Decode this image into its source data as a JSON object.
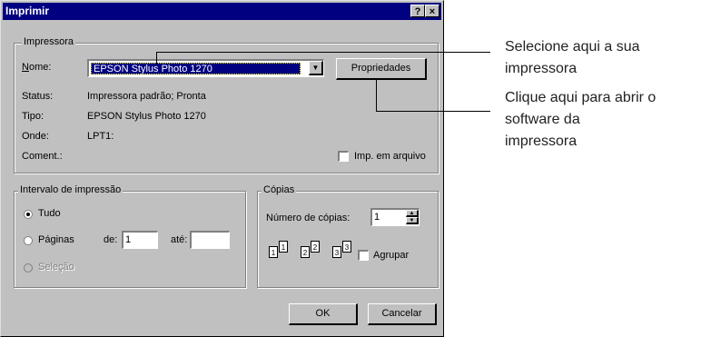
{
  "dialog": {
    "title": "Imprimir",
    "help_button": "?",
    "close_button": "×"
  },
  "printer_group": {
    "legend": "Impressora",
    "name_label": "Nome:",
    "name_value": "EPSON Stylus Photo 1270",
    "properties_button": "Propriedades",
    "status_label": "Status:",
    "status_value": "Impressora padrão; Pronta",
    "type_label": "Tipo:",
    "type_value": "EPSON Stylus Photo 1270",
    "where_label": "Onde:",
    "where_value": "LPT1:",
    "comment_label": "Coment.:",
    "print_to_file": "Imp. em arquivo"
  },
  "range_group": {
    "legend": "Intervalo de impressão",
    "all": "Tudo",
    "pages": "Páginas",
    "from_label": "de:",
    "from_value": "1",
    "to_label": "até:",
    "to_value": "",
    "selection": "Seleção",
    "selected": "all"
  },
  "copies_group": {
    "legend": "Cópias",
    "number_label": "Número de cópias:",
    "number_value": "1",
    "collate_label": "Agrupar",
    "page_numbers": [
      "1",
      "1",
      "2",
      "2",
      "3",
      "3"
    ]
  },
  "buttons": {
    "ok": "OK",
    "cancel": "Cancelar"
  },
  "callouts": {
    "select_printer_line1": "Selecione aqui a sua",
    "select_printer_line2": "impressora",
    "open_software_line1": "Clique aqui para abrir o",
    "open_software_line2": "software da",
    "open_software_line3": "impressora"
  }
}
